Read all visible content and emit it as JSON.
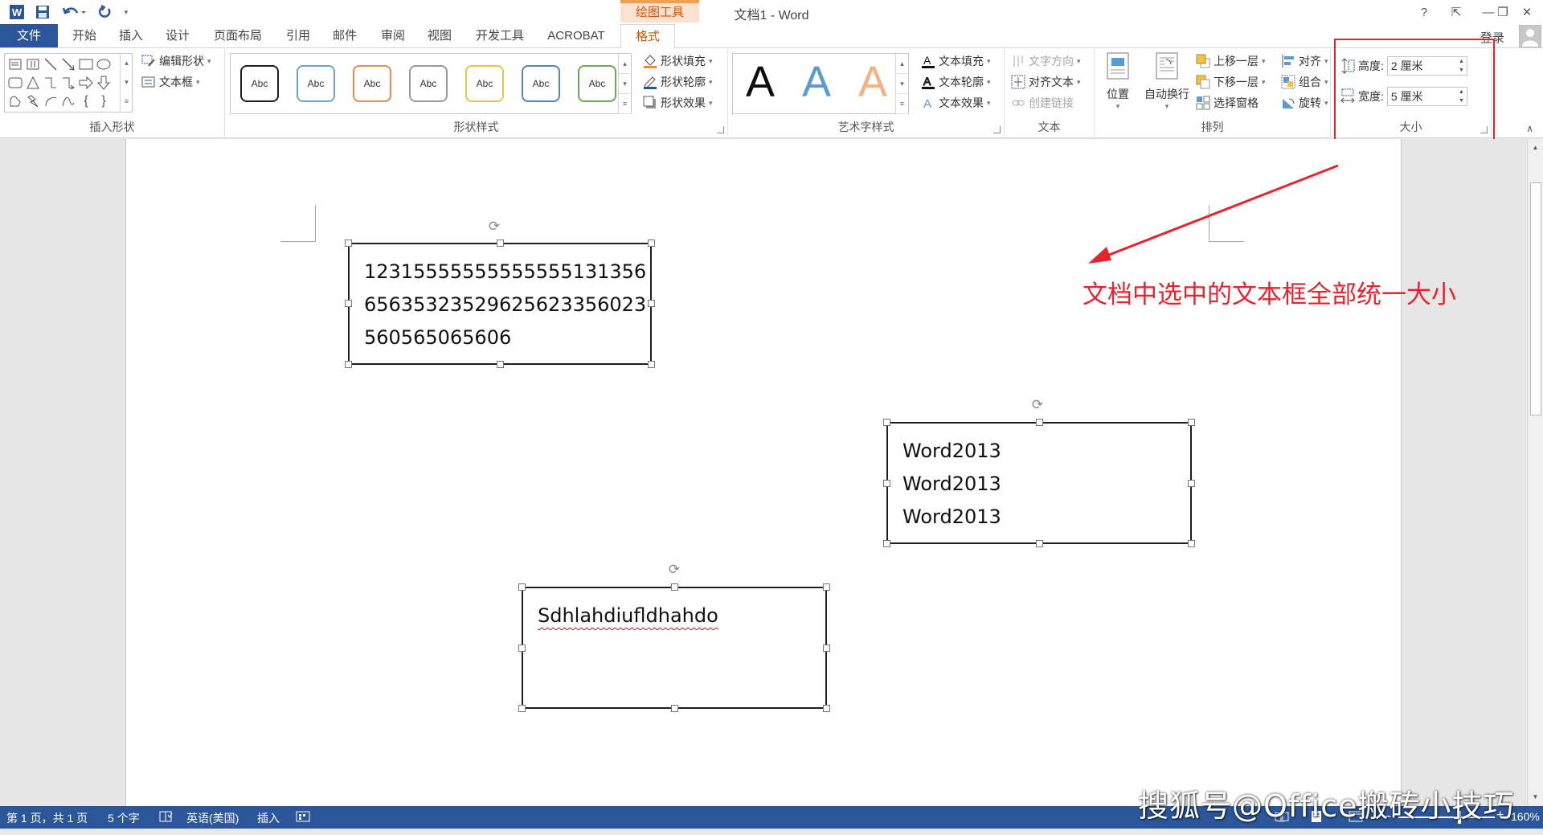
{
  "window": {
    "title": "文档1 - Word",
    "help": "?",
    "ribbon_display": "⇱",
    "minimize": "—",
    "restore": "❐",
    "close": "✕"
  },
  "context_group": "绘图工具",
  "tabs": [
    "文件",
    "开始",
    "插入",
    "设计",
    "页面布局",
    "引用",
    "邮件",
    "审阅",
    "视图",
    "开发工具",
    "ACROBAT",
    "格式"
  ],
  "account": {
    "login": "登录"
  },
  "ribbon": {
    "insert_shapes": {
      "label": "插入形状",
      "edit_shape": "编辑形状",
      "text_box": "文本框"
    },
    "shape_styles": {
      "label": "形状样式",
      "thumb_text": "Abc",
      "thumbs": [
        "#1f1f1f",
        "#6aa3d8",
        "#ee8a4a",
        "#9b9b9b",
        "#f2c244",
        "#4f86c6",
        "#6cab55"
      ],
      "shape_fill": "形状填充",
      "shape_outline": "形状轮廓",
      "shape_effects": "形状效果"
    },
    "wordart_styles": {
      "label": "艺术字样式",
      "letter": "A",
      "letter_colors": [
        "#0d0d0d",
        "#5b9bd5",
        "#f4b183"
      ],
      "text_fill": "文本填充",
      "text_outline": "文本轮廓",
      "text_effects": "文本效果"
    },
    "text": {
      "label": "文本",
      "text_direction": "文字方向",
      "align_text": "对齐文本",
      "create_link": "创建链接"
    },
    "arrange": {
      "label": "排列",
      "position": "位置",
      "wrap_text": "自动换行",
      "bring_forward": "上移一层",
      "send_backward": "下移一层",
      "selection_pane": "选择窗格",
      "align": "对齐",
      "group": "组合",
      "rotate": "旋转"
    },
    "size": {
      "label": "大小",
      "height_label": "高度:",
      "height_value": "2 厘米",
      "width_label": "宽度:",
      "width_value": "5 厘米"
    }
  },
  "document": {
    "textbox1": [
      "12315555555555555131356",
      "65635323529625623356023",
      "560565065606"
    ],
    "textbox2": [
      "Word2013",
      "Word2013",
      "Word2013"
    ],
    "textbox3": [
      "Sdhlahdiufldhahdo"
    ],
    "annotation": "文档中选中的文本框全部统一大小"
  },
  "statusbar": {
    "page": "第 1 页，共 1 页",
    "words": "5 个字",
    "language": "英语(美国)",
    "mode": "插入",
    "zoom": "160%"
  },
  "watermark": "搜狐号@Office搬砖小技巧",
  "colors": {
    "accent": "#2b579a",
    "context_orange": "#d35200",
    "annotation_red": "#e8232e"
  }
}
